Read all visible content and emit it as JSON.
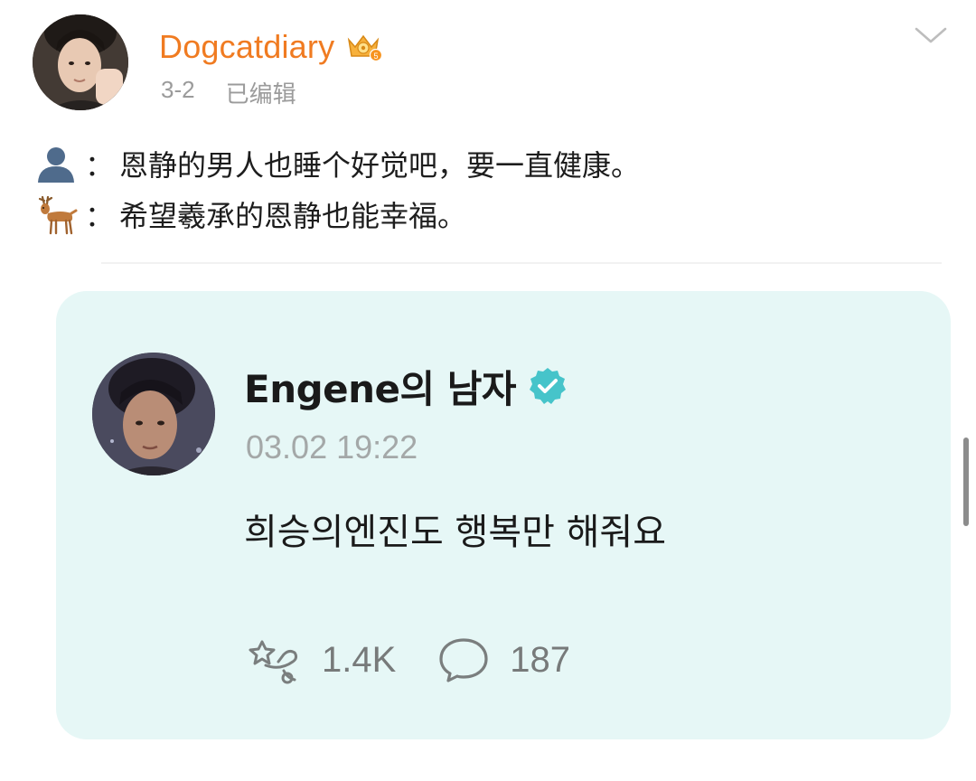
{
  "post": {
    "author": "Dogcatdiary",
    "date": "3-2",
    "edited_label": "已编辑",
    "lines": [
      {
        "emoji": "person-silhouette-emoji",
        "separator": "：",
        "text": "恩静的男人也睡个好觉吧，要一直健康。"
      },
      {
        "emoji": "deer-emoji",
        "separator": "：",
        "text": "希望羲承的恩静也能幸福。"
      }
    ]
  },
  "embedded_card": {
    "username": "Engene의 남자",
    "timestamp": "03.02 19:22",
    "text": "희승의엔진도 행복만 해줘요",
    "reactions_count": "1.4K",
    "comments_count": "187"
  },
  "colors": {
    "username": "#f07b21",
    "card_background": "#e6f7f6",
    "verified_badge": "#46c4ca",
    "meta_text": "#9b9b9b"
  }
}
